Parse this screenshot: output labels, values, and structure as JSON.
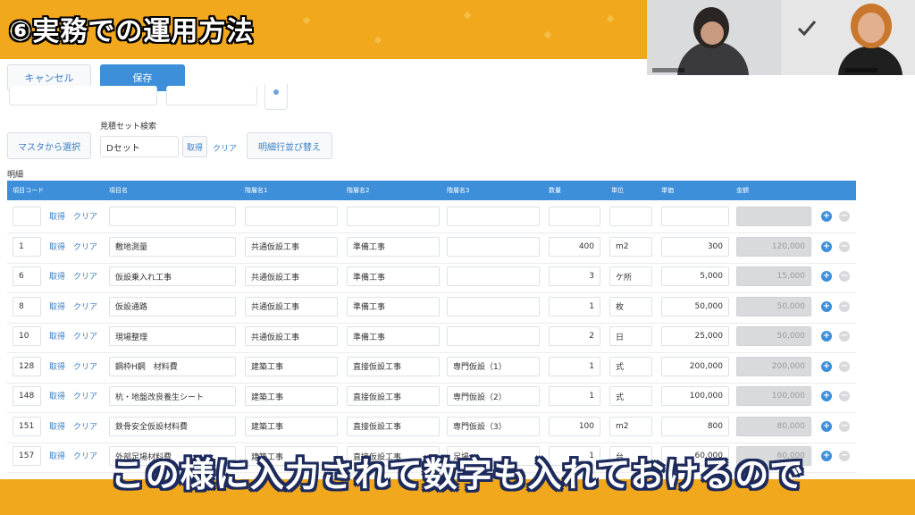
{
  "title": "⑥実務での運用方法",
  "subtitle": "この様に入力されて数字も入れておけるので",
  "toolbar": {
    "cancel_label": "キャンセル",
    "save_label": "保存"
  },
  "search": {
    "master_select_label": "マスタから選択",
    "estimate_set_label": "見積セット検索",
    "estimate_set_value": "Dセット",
    "get_label": "取得",
    "clear_label": "クリア",
    "reorder_label": "明細行並び替え"
  },
  "section_label": "明細",
  "columns": [
    "項目コード",
    "項目名",
    "階層名1",
    "階層名2",
    "階層名3",
    "数量",
    "単位",
    "単価",
    "金額"
  ],
  "row_actions": {
    "get": "取得",
    "clear": "クリア"
  },
  "rows": [
    {
      "code": "",
      "name": "",
      "l1": "",
      "l2": "",
      "l3": "",
      "qty": "",
      "unit": "",
      "price": "",
      "amount": ""
    },
    {
      "code": "1",
      "name": "敷地測量",
      "l1": "共通仮設工事",
      "l2": "準備工事",
      "l3": "",
      "qty": "400",
      "unit": "m2",
      "price": "300",
      "amount": "120,000"
    },
    {
      "code": "6",
      "name": "仮設乗入れ工事",
      "l1": "共通仮設工事",
      "l2": "準備工事",
      "l3": "",
      "qty": "3",
      "unit": "ケ所",
      "price": "5,000",
      "amount": "15,000"
    },
    {
      "code": "8",
      "name": "仮設通路",
      "l1": "共通仮設工事",
      "l2": "準備工事",
      "l3": "",
      "qty": "1",
      "unit": "枚",
      "price": "50,000",
      "amount": "50,000"
    },
    {
      "code": "10",
      "name": "現場整理",
      "l1": "共通仮設工事",
      "l2": "準備工事",
      "l3": "",
      "qty": "2",
      "unit": "日",
      "price": "25,000",
      "amount": "50,000"
    },
    {
      "code": "128",
      "name": "鋼枠H鋼　材料費",
      "l1": "建築工事",
      "l2": "直接仮設工事",
      "l3": "専門仮設（1）",
      "qty": "1",
      "unit": "式",
      "price": "200,000",
      "amount": "200,000"
    },
    {
      "code": "148",
      "name": "杭・地盤改良養生シート",
      "l1": "建築工事",
      "l2": "直接仮設工事",
      "l3": "専門仮設（2）",
      "qty": "1",
      "unit": "式",
      "price": "100,000",
      "amount": "100,000"
    },
    {
      "code": "151",
      "name": "鉄骨安全仮設材料費",
      "l1": "建築工事",
      "l2": "直接仮設工事",
      "l3": "専門仮設（3）",
      "qty": "100",
      "unit": "m2",
      "price": "800",
      "amount": "80,000"
    },
    {
      "code": "157",
      "name": "外部足場材料費",
      "l1": "建築工事",
      "l2": "直接仮設工事",
      "l3": "足場",
      "qty": "1",
      "unit": "台",
      "price": "60,000",
      "amount": "60,000"
    }
  ],
  "colors": {
    "accent": "#3d8fd9",
    "frame": "#f2a81c",
    "subtitle_outline": "#1c2a5c"
  },
  "icons": {
    "add": "plus-icon",
    "remove": "minus-icon",
    "bookmark": "bookmark-icon"
  }
}
